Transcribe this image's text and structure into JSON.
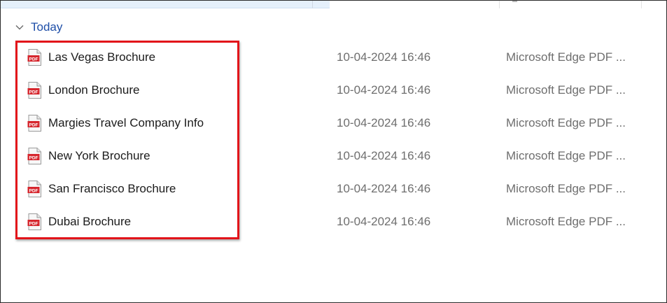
{
  "group": {
    "label": "Today"
  },
  "files": [
    {
      "name": "Las Vegas Brochure",
      "date": "10-04-2024 16:46",
      "type": "Microsoft Edge PDF ..."
    },
    {
      "name": "London Brochure",
      "date": "10-04-2024 16:46",
      "type": "Microsoft Edge PDF ..."
    },
    {
      "name": "Margies Travel Company Info",
      "date": "10-04-2024 16:46",
      "type": "Microsoft Edge PDF ..."
    },
    {
      "name": "New York Brochure",
      "date": "10-04-2024 16:46",
      "type": "Microsoft Edge PDF ..."
    },
    {
      "name": "San Francisco Brochure",
      "date": "10-04-2024 16:46",
      "type": "Microsoft Edge PDF ..."
    },
    {
      "name": "Dubai Brochure",
      "date": "10-04-2024 16:46",
      "type": "Microsoft Edge PDF ..."
    }
  ],
  "icons": {
    "file": "pdf-file-icon",
    "group_toggle": "chevron-down-icon"
  },
  "colors": {
    "highlight": "#e2141a",
    "group_label": "#1f4fa8",
    "pdf_red": "#d6262d"
  }
}
